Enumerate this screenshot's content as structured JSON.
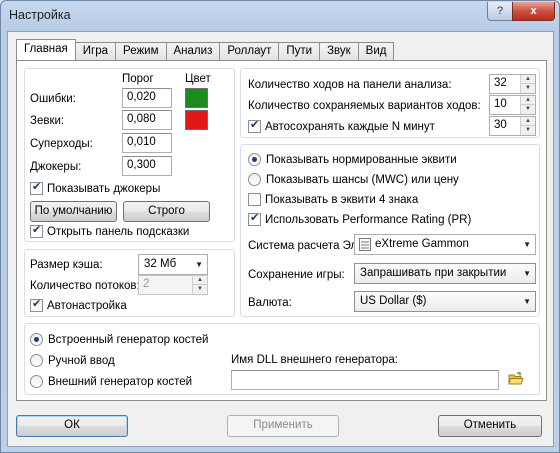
{
  "window": {
    "title": "Настройка"
  },
  "tabs": [
    "Главная",
    "Игра",
    "Режим",
    "Анализ",
    "Роллаут",
    "Пути",
    "Звук",
    "Вид"
  ],
  "thresholds": {
    "header_threshold": "Порог",
    "header_color": "Цвет",
    "rows": [
      {
        "label": "Ошибки:",
        "value": "0,020",
        "color": "#1c8a1c"
      },
      {
        "label": "Зевки:",
        "value": "0,080",
        "color": "#e21717"
      },
      {
        "label": "Суперходы:",
        "value": "0,010"
      },
      {
        "label": "Джокеры:",
        "value": "0,300"
      }
    ],
    "show_jokers": "Показывать джокеры",
    "default_button": "По умолчанию",
    "strict_button": "Строго",
    "open_hints": "Открыть панель подсказки"
  },
  "cache": {
    "size_label": "Размер кэша:",
    "size_value": "32 Мб",
    "threads_label": "Количество потоков:",
    "threads_value": "2",
    "auto_tune": "Автонастройка"
  },
  "analysis": {
    "moves_label": "Количество ходов на панели анализа:",
    "moves_value": "32",
    "saved_label": "Количество сохраняемых вариантов ходов:",
    "saved_value": "10",
    "autosave_label": "Автосохранять каждые N минут",
    "autosave_value": "30"
  },
  "options": {
    "radio_normalized": "Показывать нормированные эквити",
    "radio_mwc": "Показывать шансы (MWC) или цену",
    "equity4": "Показывать в эквити 4 знака",
    "perf_rating": "Использовать Performance Rating (PR)",
    "elo_label": "Система расчета Эло:",
    "elo_value": "eXtreme Gammon",
    "save_label": "Сохранение игры:",
    "save_value": "Запрашивать при закрытии",
    "currency_label": "Валюта:",
    "currency_value": "US Dollar ($)"
  },
  "dice": {
    "builtin": "Встроенный генератор костей",
    "manual": "Ручной ввод",
    "external": "Внешний генератор костей",
    "dll_label": "Имя DLL внешнего генератора:",
    "dll_value": ""
  },
  "footer": {
    "ok": "ОК",
    "apply": "Применить",
    "cancel": "Отменить"
  },
  "icons": {
    "help": "?",
    "close": "x",
    "spin_up": "▲",
    "spin_down": "▼",
    "combo_arrow": "▼"
  }
}
